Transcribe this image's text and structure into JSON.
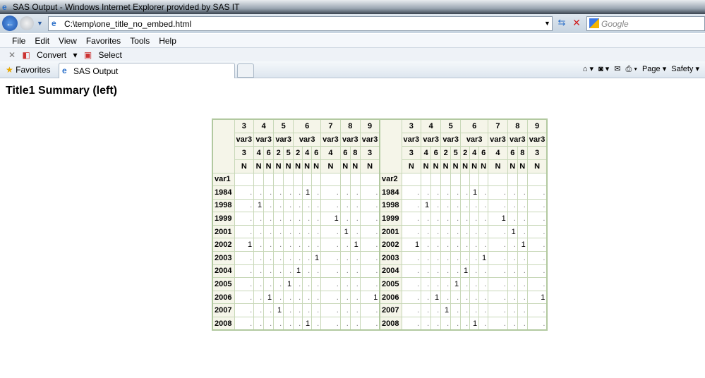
{
  "window": {
    "title": "SAS Output - Windows Internet Explorer provided by SAS IT"
  },
  "address": {
    "url": "C:\\temp\\one_title_no_embed.html",
    "search_placeholder": "Google"
  },
  "menu": [
    "File",
    "Edit",
    "View",
    "Favorites",
    "Tools",
    "Help"
  ],
  "commandbar": {
    "close": "✕",
    "convert": "Convert",
    "select": "Select"
  },
  "tabs": {
    "favorites": "Favorites",
    "active": "SAS Output"
  },
  "tools": {
    "page": "Page ▾",
    "safety": "Safety ▾"
  },
  "page": {
    "title": "Title1 Summary (left)"
  },
  "columns": {
    "top": [
      {
        "label": "3",
        "span": 1
      },
      {
        "label": "4",
        "span": 2
      },
      {
        "label": "5",
        "span": 2
      },
      {
        "label": "6",
        "span": 3
      },
      {
        "label": "7",
        "span": 1
      },
      {
        "label": "8",
        "span": 2
      },
      {
        "label": "9",
        "span": 1
      }
    ],
    "var_label": "var3",
    "values": [
      "3",
      "4",
      "6",
      "2",
      "5",
      "2",
      "4",
      "6",
      "4",
      "6",
      "8",
      "3"
    ],
    "stat": "N"
  },
  "tables": [
    {
      "row_var": "var1",
      "rows": [
        {
          "label": "1984",
          "cells": [
            ".",
            ".",
            ".",
            ".",
            ".",
            ".",
            "1",
            ".",
            ".",
            ".",
            ".",
            "."
          ]
        },
        {
          "label": "1998",
          "cells": [
            ".",
            "1",
            ".",
            ".",
            ".",
            ".",
            ".",
            ".",
            ".",
            ".",
            ".",
            "."
          ]
        },
        {
          "label": "1999",
          "cells": [
            ".",
            ".",
            ".",
            ".",
            ".",
            ".",
            ".",
            ".",
            "1",
            ".",
            ".",
            "."
          ]
        },
        {
          "label": "2001",
          "cells": [
            ".",
            ".",
            ".",
            ".",
            ".",
            ".",
            ".",
            ".",
            ".",
            "1",
            ".",
            "."
          ]
        },
        {
          "label": "2002",
          "cells": [
            "1",
            ".",
            ".",
            ".",
            ".",
            ".",
            ".",
            ".",
            ".",
            ".",
            "1",
            "."
          ]
        },
        {
          "label": "2003",
          "cells": [
            ".",
            ".",
            ".",
            ".",
            ".",
            ".",
            ".",
            "1",
            ".",
            ".",
            ".",
            "."
          ]
        },
        {
          "label": "2004",
          "cells": [
            ".",
            ".",
            ".",
            ".",
            ".",
            "1",
            ".",
            ".",
            ".",
            ".",
            ".",
            "."
          ]
        },
        {
          "label": "2005",
          "cells": [
            ".",
            ".",
            ".",
            ".",
            "1",
            ".",
            ".",
            ".",
            ".",
            ".",
            ".",
            "."
          ]
        },
        {
          "label": "2006",
          "cells": [
            ".",
            ".",
            "1",
            ".",
            ".",
            ".",
            ".",
            ".",
            ".",
            ".",
            ".",
            "1"
          ]
        },
        {
          "label": "2007",
          "cells": [
            ".",
            ".",
            ".",
            "1",
            ".",
            ".",
            ".",
            ".",
            ".",
            ".",
            ".",
            "."
          ]
        },
        {
          "label": "2008",
          "cells": [
            ".",
            ".",
            ".",
            ".",
            ".",
            ".",
            "1",
            ".",
            ".",
            ".",
            ".",
            "."
          ]
        }
      ]
    },
    {
      "row_var": "var2",
      "rows": [
        {
          "label": "1984",
          "cells": [
            ".",
            ".",
            ".",
            ".",
            ".",
            ".",
            "1",
            ".",
            ".",
            ".",
            ".",
            "."
          ]
        },
        {
          "label": "1998",
          "cells": [
            ".",
            "1",
            ".",
            ".",
            ".",
            ".",
            ".",
            ".",
            ".",
            ".",
            ".",
            "."
          ]
        },
        {
          "label": "1999",
          "cells": [
            ".",
            ".",
            ".",
            ".",
            ".",
            ".",
            ".",
            ".",
            "1",
            ".",
            ".",
            "."
          ]
        },
        {
          "label": "2001",
          "cells": [
            ".",
            ".",
            ".",
            ".",
            ".",
            ".",
            ".",
            ".",
            ".",
            "1",
            ".",
            "."
          ]
        },
        {
          "label": "2002",
          "cells": [
            "1",
            ".",
            ".",
            ".",
            ".",
            ".",
            ".",
            ".",
            ".",
            ".",
            "1",
            "."
          ]
        },
        {
          "label": "2003",
          "cells": [
            ".",
            ".",
            ".",
            ".",
            ".",
            ".",
            ".",
            "1",
            ".",
            ".",
            ".",
            "."
          ]
        },
        {
          "label": "2004",
          "cells": [
            ".",
            ".",
            ".",
            ".",
            ".",
            "1",
            ".",
            ".",
            ".",
            ".",
            ".",
            "."
          ]
        },
        {
          "label": "2005",
          "cells": [
            ".",
            ".",
            ".",
            ".",
            "1",
            ".",
            ".",
            ".",
            ".",
            ".",
            ".",
            "."
          ]
        },
        {
          "label": "2006",
          "cells": [
            ".",
            ".",
            "1",
            ".",
            ".",
            ".",
            ".",
            ".",
            ".",
            ".",
            ".",
            "1"
          ]
        },
        {
          "label": "2007",
          "cells": [
            ".",
            ".",
            ".",
            "1",
            ".",
            ".",
            ".",
            ".",
            ".",
            ".",
            ".",
            "."
          ]
        },
        {
          "label": "2008",
          "cells": [
            ".",
            ".",
            ".",
            ".",
            ".",
            ".",
            "1",
            ".",
            ".",
            ".",
            ".",
            "."
          ]
        }
      ]
    }
  ]
}
